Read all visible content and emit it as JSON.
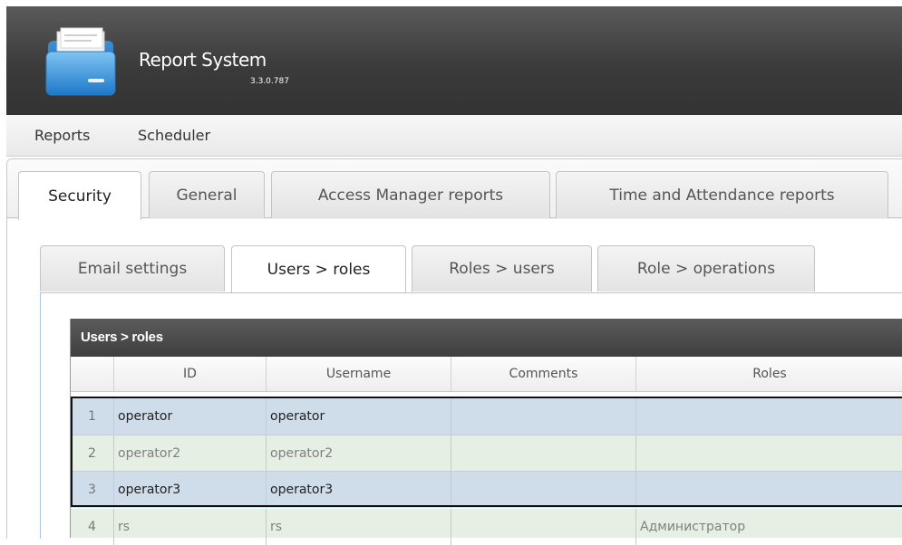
{
  "app": {
    "title": "Report System",
    "version": "3.3.0.787",
    "logo_icon": "folder-icon"
  },
  "menu": {
    "items": [
      "Reports",
      "Scheduler"
    ]
  },
  "outer_tabs": {
    "items": [
      "Security",
      "General",
      "Access Manager reports",
      "Time and Attendance reports"
    ],
    "active": "Security"
  },
  "inner_tabs": {
    "items": [
      "Email settings",
      "Users > roles",
      "Roles > users",
      "Role > operations"
    ],
    "active": "Users > roles"
  },
  "grid": {
    "title": "Users > roles",
    "columns": [
      "",
      "ID",
      "Username",
      "Comments",
      "Roles"
    ],
    "rows": [
      {
        "num": "1",
        "id": "operator",
        "username": "operator",
        "comments": "",
        "roles": ""
      },
      {
        "num": "2",
        "id": "operator2",
        "username": "operator2",
        "comments": "",
        "roles": ""
      },
      {
        "num": "3",
        "id": "operator3",
        "username": "operator3",
        "comments": "",
        "roles": ""
      },
      {
        "num": "4",
        "id": "rs",
        "username": "rs",
        "comments": "",
        "roles": "Администратор"
      }
    ]
  },
  "colors": {
    "header_bg": "#3b3b3b",
    "selected_row": "#cfdcea",
    "alt_row": "#e6efe3",
    "inner_border": "#a9c6e4"
  }
}
